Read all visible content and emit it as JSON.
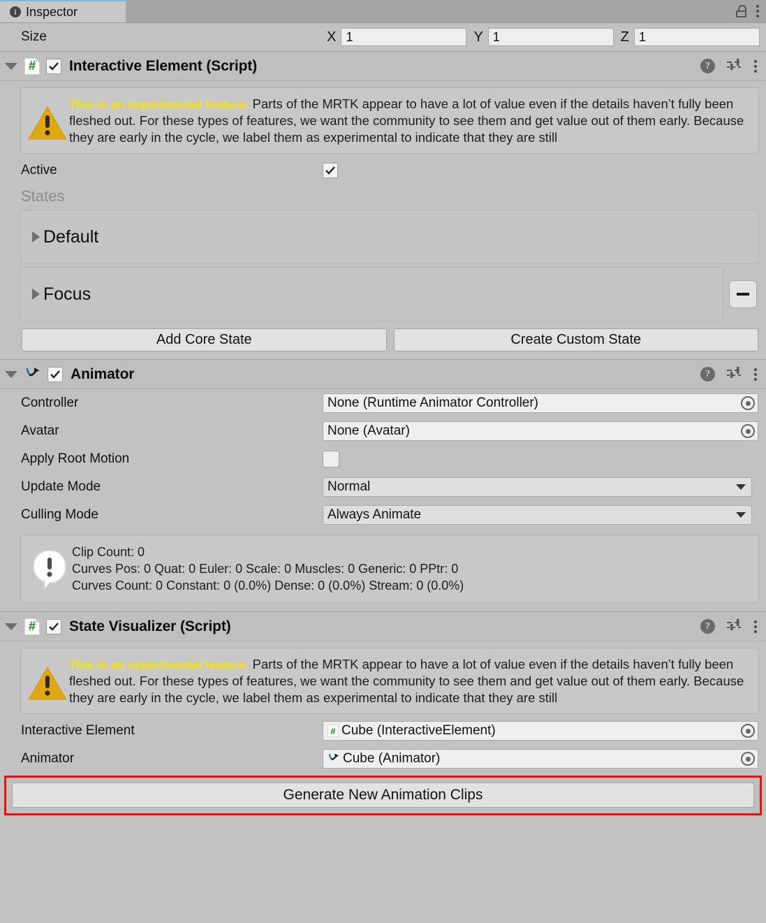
{
  "window": {
    "tab_label": "Inspector",
    "tab_icon": "info-icon",
    "lock_icon": "lock-open-icon",
    "menu_icon": "kebab-menu-icon"
  },
  "size_row": {
    "label": "Size",
    "axes": [
      {
        "axis": "X",
        "value": "1"
      },
      {
        "axis": "Y",
        "value": "1"
      },
      {
        "axis": "Z",
        "value": "1"
      }
    ]
  },
  "experimental_warning": {
    "title": "This is an experimental feature.",
    "body": "Parts of the MRTK appear to have a lot of value even if the details haven’t fully been fleshed out. For these types of features, we want the community to see them and get value out of them early. Because they are early in the cycle, we label them as experimental to indicate that they are still",
    "icon": "warning-triangle-icon"
  },
  "interactive_element": {
    "title": "Interactive Element (Script)",
    "icon": "script-icon",
    "enabled": true,
    "help_icon": "help-icon",
    "preset_icon": "preset-sliders-icon",
    "menu_icon": "kebab-menu-icon",
    "active_label": "Active",
    "active_checked": true,
    "states_label": "States",
    "states": [
      {
        "name": "Default",
        "removable": false
      },
      {
        "name": "Focus",
        "removable": true
      }
    ],
    "remove_button_label": "−",
    "add_core_state_label": "Add Core State",
    "create_custom_state_label": "Create Custom State"
  },
  "animator": {
    "title": "Animator",
    "icon": "animator-icon",
    "enabled": true,
    "help_icon": "help-icon",
    "preset_icon": "preset-sliders-icon",
    "menu_icon": "kebab-menu-icon",
    "fields": [
      {
        "label": "Controller",
        "value": "None (Runtime Animator Controller)",
        "type": "object"
      },
      {
        "label": "Avatar",
        "value": "None (Avatar)",
        "type": "object"
      },
      {
        "label": "Apply Root Motion",
        "value": "",
        "type": "checkbox",
        "checked": false
      },
      {
        "label": "Update Mode",
        "value": "Normal",
        "type": "popup"
      },
      {
        "label": "Culling Mode",
        "value": "Always Animate",
        "type": "popup"
      }
    ],
    "info": {
      "icon": "info-bubble-icon",
      "lines": [
        "Clip Count: 0",
        "Curves Pos: 0 Quat: 0 Euler: 0 Scale: 0 Muscles: 0 Generic: 0 PPtr: 0",
        "Curves Count: 0 Constant: 0 (0.0%) Dense: 0 (0.0%) Stream: 0 (0.0%)"
      ],
      "text": "Clip Count: 0\nCurves Pos: 0 Quat: 0 Euler: 0 Scale: 0 Muscles: 0 Generic: 0 PPtr: 0\nCurves Count: 0 Constant: 0 (0.0%) Dense: 0 (0.0%) Stream: 0 (0.0%)"
    }
  },
  "state_visualizer": {
    "title": "State Visualizer (Script)",
    "icon": "script-icon",
    "enabled": true,
    "help_icon": "help-icon",
    "preset_icon": "preset-sliders-icon",
    "menu_icon": "kebab-menu-icon",
    "fields": [
      {
        "label": "Interactive Element",
        "value": "Cube (InteractiveElement)",
        "icon": "script-icon"
      },
      {
        "label": "Animator",
        "value": "Cube (Animator)",
        "icon": "animator-icon"
      }
    ],
    "generate_button_label": "Generate New Animation Clips",
    "highlight_color": "#f20c0c"
  },
  "colors": {
    "panel_bg": "#c2c2c2",
    "header_bg": "#bfbfbf",
    "tabbar_bg": "#a5a5a5",
    "tab_bg": "#c8c8c8",
    "field_bg": "#efefef",
    "button_bg": "#e2e2e2",
    "warning_yellow": "#f5e300",
    "warning_triangle": "#e0a713",
    "script_green": "#118a2b",
    "states_label_gray": "#8c8c8c",
    "highlight_red": "#f20c0c"
  }
}
